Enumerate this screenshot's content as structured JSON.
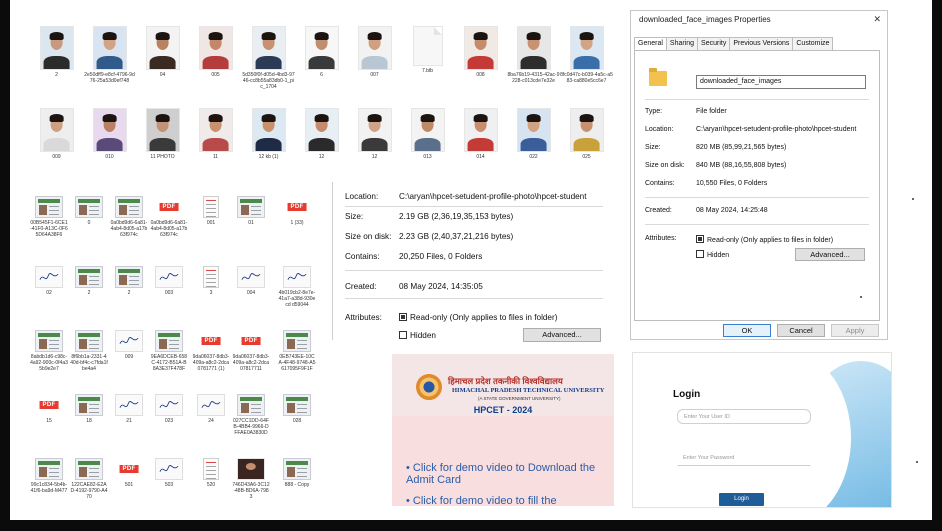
{
  "grid1": [
    {
      "label": "2",
      "skin": "#c79a7d",
      "bg": "#dce6ef",
      "shirt": "#2b2b2b"
    },
    {
      "label": "2e50dff9-e8cf-4796-9d76-25a53d0ef748",
      "skin": "#d2a485",
      "bg": "#d9e4f2",
      "shirt": "#2f5a8a"
    },
    {
      "label": "04",
      "skin": "#b98362",
      "bg": "#f3f3f3",
      "shirt": "#3b2a22"
    },
    {
      "label": "005",
      "skin": "#c4876a",
      "bg": "#f0e7e5",
      "shirt": "#b43c3c"
    },
    {
      "label": "5d350f0f-d05d-4bd3-9746-cc8b55a83db0-1_pic_1704",
      "skin": "#c9916f",
      "bg": "#e9eef3",
      "shirt": "#2b3a55"
    },
    {
      "label": "6",
      "skin": "#c18e6f",
      "bg": "#f7f7f7",
      "shirt": "#3a3a3a"
    },
    {
      "label": "007",
      "skin": "#d0a080",
      "bg": "#f2f2f2",
      "shirt": "#b9c6d4"
    },
    {
      "label": "7.btb",
      "skin": "",
      "bg": "#f7f7f7",
      "shirt": ""
    },
    {
      "label": "008",
      "skin": "#c58c6a",
      "bg": "#f1e9e4",
      "shirt": "#c53a36"
    },
    {
      "label": "8ba76b19-4315-42ac-9228-c013cde7e32e",
      "skin": "#c99272",
      "bg": "#e7e7e7",
      "shirt": "#2d2d2d"
    },
    {
      "label": "8fc0d47c-b039-4a5c-a583-ca880e5cc6e7",
      "skin": "#d2a385",
      "bg": "#dbe7f3",
      "shirt": "#3a6ea8"
    }
  ],
  "grid2": [
    {
      "label": "009",
      "skin": "#cf9f82",
      "bg": "#eeeeee",
      "shirt": "#d9d9d9"
    },
    {
      "label": "010",
      "skin": "#b98163",
      "bg": "#e9d9ef",
      "shirt": "#5a4a7a"
    },
    {
      "label": "11 PHOTO",
      "skin": "#c29275",
      "bg": "#cfcfcf",
      "shirt": "#3a3a3a"
    },
    {
      "label": "11",
      "skin": "#c8916f",
      "bg": "#f0ebea",
      "shirt": "#b84a4a"
    },
    {
      "label": "12 kb (1)",
      "skin": "#c9906d",
      "bg": "#dce9f3",
      "shirt": "#1f2a44"
    },
    {
      "label": "12",
      "skin": "#c48b6d",
      "bg": "#e7eef4",
      "shirt": "#2a2a2a"
    },
    {
      "label": "12",
      "skin": "#d0a487",
      "bg": "#f2f2f2",
      "shirt": "#3a3a3a"
    },
    {
      "label": "013",
      "skin": "#c08a68",
      "bg": "#f3f3f3",
      "shirt": "#5a6f8a"
    },
    {
      "label": "014",
      "skin": "#c98e6c",
      "bg": "#eff0f2",
      "shirt": "#c43a34"
    },
    {
      "label": "022",
      "skin": "#d1a383",
      "bg": "#d6e4f2",
      "shirt": "#3a5e9a"
    },
    {
      "label": "025",
      "skin": "#c69171",
      "bg": "#eeeeee",
      "shirt": "#c9a13a"
    }
  ],
  "files": {
    "row1": [
      "00B545F1-6CE1-41F0-A13C-0F65D64A38F6",
      "0",
      "0a0bd9d6-6a81-4ab4-8d05-a17b63f974c",
      "0a0bd9d6-6a81-4ab4-8d05-a17b63f974c",
      "001",
      "01",
      "1 (33)"
    ],
    "row2": [
      "02",
      "2",
      "2",
      "003",
      "3",
      "004",
      "4b019cb2-8e7e-41a7-a38d-930ecd d59044"
    ],
    "row3": [
      "8abdb1d6-c98c-4a92-900c-0f4a35b9e2e7",
      "8f6bb1a-2331-440d-bf4c-c7fda1fbe4a4",
      "009",
      "9EA6DCEB-658C-4172-B51A-B8A3E37F478F",
      "9da06037-8db3-409a-a8c2-2dca0781771 (1)",
      "9da06037-8db3-409a-a8c2-2dca07817711",
      "0EB743EE-10CA-4F48-9748-A5617095F9F1F"
    ],
    "row4": [
      "15",
      "18",
      "21",
      "023",
      "24",
      "027CC1DD-64FB-4BB4-9966-DFFAE0A3830D",
      "028"
    ],
    "row5": [
      "99c1c834-5b4b-41f6-ba9d-M477",
      "122CAE82-E2AD-4192-9790-A470",
      "501",
      "503",
      "520",
      "746D43A6-3C12-48B-BD6A-7983",
      "888 - Copy"
    ],
    "pdf": "PDF"
  },
  "props_mid": {
    "location_label": "Location:",
    "location_value": "C:\\aryan\\hpcet-setudent-profile-photo\\hpcet-student",
    "size_label": "Size:",
    "size_value": "2.19 GB (2,36,19,35,153 bytes)",
    "size_disk_label": "Size on disk:",
    "size_disk_value": "2.23 GB (2,40,37,21,216 bytes)",
    "contains_label": "Contains:",
    "contains_value": "20,250 Files, 0 Folders",
    "created_label": "Created:",
    "created_value": "08 May 2024, 14:35:05",
    "attributes_label": "Attributes:",
    "readonly_label": "Read-only (Only applies to files in folder)",
    "hidden_label": "Hidden",
    "advanced_label": "Advanced..."
  },
  "dialog": {
    "title": "downloaded_face_images Properties",
    "close": "✕",
    "tabs": [
      "General",
      "Sharing",
      "Security",
      "Previous Versions",
      "Customize"
    ],
    "name_value": "downloaded_face_images",
    "type_label": "Type:",
    "type_value": "File folder",
    "location_label": "Location:",
    "location_value": "C:\\aryan\\hpcet-setudent-profile-photo\\hpcet-student",
    "size_label": "Size:",
    "size_value": "820 MB (85,99,21,565 bytes)",
    "size_disk_label": "Size on disk:",
    "size_disk_value": "840 MB (88,16,55,808 bytes)",
    "contains_label": "Contains:",
    "contains_value": "10,550 Files, 0 Folders",
    "created_label": "Created:",
    "created_value": "08 May 2024, 14:25:48",
    "attributes_label": "Attributes:",
    "readonly_label": "Read-only (Only applies to files in folder)",
    "hidden_label": "Hidden",
    "advanced_label": "Advanced...",
    "ok_label": "OK",
    "cancel_label": "Cancel",
    "apply_label": "Apply"
  },
  "hpcet": {
    "hindi": "हिमाचल प्रदेश तकनीकी विश्वविद्यालय",
    "english": "HIMACHAL PRADESH TECHNICAL UNIVERSITY",
    "sub": "(A STATE GOVERNMENT UNIVERSITY)",
    "year": "HPCET - 2024",
    "link1": "• Click for demo video to Download the Admit Card",
    "link2": "• Click for demo video to fill the"
  },
  "login": {
    "title": "Login",
    "userid_placeholder": "Enter Your User ID",
    "password_placeholder": "Enter Your Password",
    "button": "Login"
  }
}
